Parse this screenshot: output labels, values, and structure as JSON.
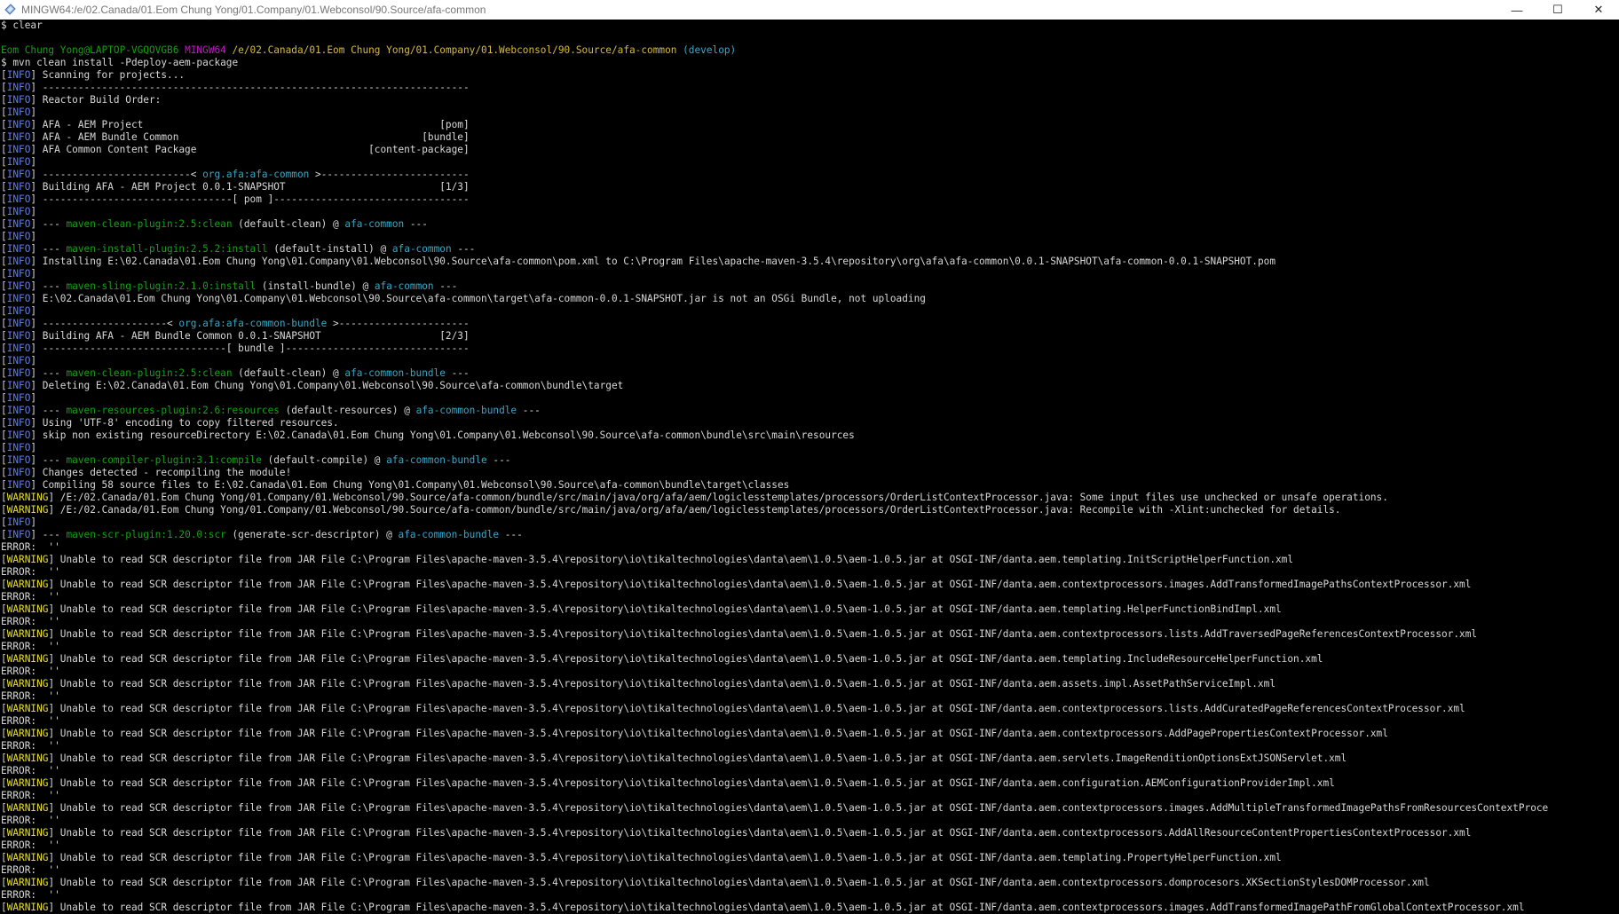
{
  "window": {
    "title": "MINGW64:/e/02.Canada/01.Eom Chung Yong/01.Company/01.Webconsol/90.Source/afa-common",
    "minimize": "—",
    "maximize": "☐",
    "close": "✕"
  },
  "colors": {
    "background": "#000000",
    "text": "#d8d8d8",
    "info_tag": "#5c7cfa",
    "warning_tag": "#e8e02a",
    "plugin": "#16a016",
    "artifact": "#3aa7c8",
    "user": "#13a10e",
    "shell": "#c218c2",
    "path": "#d7ba3e"
  },
  "lines": [
    [
      {
        "t": "$ clear"
      }
    ],
    [
      {
        "t": ""
      }
    ],
    [
      {
        "t": "Eom Chung Yong@LAPTOP-VGQOVGB6 ",
        "c": "green"
      },
      {
        "t": "MINGW64 ",
        "c": "magenta"
      },
      {
        "t": "/e/02.Canada/01.Eom Chung Yong/01.Company/01.Webconsol/90.Source/afa-common",
        "c": "yellow"
      },
      {
        "t": " (develop)",
        "c": "cyan"
      }
    ],
    [
      {
        "t": "$ mvn clean install -Pdeploy-aem-package"
      }
    ],
    [
      {
        "t": "[",
        "c": "white"
      },
      {
        "t": "INFO",
        "c": "blue"
      },
      {
        "t": "] Scanning for projects..."
      }
    ],
    [
      {
        "t": "["
      },
      {
        "t": "INFO",
        "c": "blue"
      },
      {
        "t": "] ------------------------------------------------------------------------"
      }
    ],
    [
      {
        "t": "["
      },
      {
        "t": "INFO",
        "c": "blue"
      },
      {
        "t": "] Reactor Build Order:"
      }
    ],
    [
      {
        "t": "["
      },
      {
        "t": "INFO",
        "c": "blue"
      },
      {
        "t": "]"
      }
    ],
    [
      {
        "t": "["
      },
      {
        "t": "INFO",
        "c": "blue"
      },
      {
        "t": "] AFA - AEM Project                                                  [pom]"
      }
    ],
    [
      {
        "t": "["
      },
      {
        "t": "INFO",
        "c": "blue"
      },
      {
        "t": "] AFA - AEM Bundle Common                                         [bundle]"
      }
    ],
    [
      {
        "t": "["
      },
      {
        "t": "INFO",
        "c": "blue"
      },
      {
        "t": "] AFA Common Content Package                             [content-package]"
      }
    ],
    [
      {
        "t": "["
      },
      {
        "t": "INFO",
        "c": "blue"
      },
      {
        "t": "]"
      }
    ],
    [
      {
        "t": "["
      },
      {
        "t": "INFO",
        "c": "blue"
      },
      {
        "t": "] -------------------------< "
      },
      {
        "t": "org.afa:afa-common",
        "c": "cyan"
      },
      {
        "t": " >-------------------------"
      }
    ],
    [
      {
        "t": "["
      },
      {
        "t": "INFO",
        "c": "blue"
      },
      {
        "t": "] Building AFA - AEM Project 0.0.1-SNAPSHOT                          [1/3]"
      }
    ],
    [
      {
        "t": "["
      },
      {
        "t": "INFO",
        "c": "blue"
      },
      {
        "t": "] --------------------------------[ pom ]---------------------------------"
      }
    ],
    [
      {
        "t": "["
      },
      {
        "t": "INFO",
        "c": "blue"
      },
      {
        "t": "]"
      }
    ],
    [
      {
        "t": "["
      },
      {
        "t": "INFO",
        "c": "blue"
      },
      {
        "t": "] --- "
      },
      {
        "t": "maven-clean-plugin:2.5:clean",
        "c": "plugin"
      },
      {
        "t": " (default-clean) @ "
      },
      {
        "t": "afa-common",
        "c": "cyan"
      },
      {
        "t": " ---"
      }
    ],
    [
      {
        "t": "["
      },
      {
        "t": "INFO",
        "c": "blue"
      },
      {
        "t": "]"
      }
    ],
    [
      {
        "t": "["
      },
      {
        "t": "INFO",
        "c": "blue"
      },
      {
        "t": "] --- "
      },
      {
        "t": "maven-install-plugin:2.5.2:install",
        "c": "plugin"
      },
      {
        "t": " (default-install) @ "
      },
      {
        "t": "afa-common",
        "c": "cyan"
      },
      {
        "t": " ---"
      }
    ],
    [
      {
        "t": "["
      },
      {
        "t": "INFO",
        "c": "blue"
      },
      {
        "t": "] Installing E:\\02.Canada\\01.Eom Chung Yong\\01.Company\\01.Webconsol\\90.Source\\afa-common\\pom.xml to C:\\Program Files\\apache-maven-3.5.4\\repository\\org\\afa\\afa-common\\0.0.1-SNAPSHOT\\afa-common-0.0.1-SNAPSHOT.pom"
      }
    ],
    [
      {
        "t": "["
      },
      {
        "t": "INFO",
        "c": "blue"
      },
      {
        "t": "]"
      }
    ],
    [
      {
        "t": "["
      },
      {
        "t": "INFO",
        "c": "blue"
      },
      {
        "t": "] --- "
      },
      {
        "t": "maven-sling-plugin:2.1.0:install",
        "c": "plugin"
      },
      {
        "t": " (install-bundle) @ "
      },
      {
        "t": "afa-common",
        "c": "cyan"
      },
      {
        "t": " ---"
      }
    ],
    [
      {
        "t": "["
      },
      {
        "t": "INFO",
        "c": "blue"
      },
      {
        "t": "] E:\\02.Canada\\01.Eom Chung Yong\\01.Company\\01.Webconsol\\90.Source\\afa-common\\target\\afa-common-0.0.1-SNAPSHOT.jar is not an OSGi Bundle, not uploading"
      }
    ],
    [
      {
        "t": "["
      },
      {
        "t": "INFO",
        "c": "blue"
      },
      {
        "t": "]"
      }
    ],
    [
      {
        "t": "["
      },
      {
        "t": "INFO",
        "c": "blue"
      },
      {
        "t": "] ---------------------< "
      },
      {
        "t": "org.afa:afa-common-bundle",
        "c": "cyan"
      },
      {
        "t": " >----------------------"
      }
    ],
    [
      {
        "t": "["
      },
      {
        "t": "INFO",
        "c": "blue"
      },
      {
        "t": "] Building AFA - AEM Bundle Common 0.0.1-SNAPSHOT                    [2/3]"
      }
    ],
    [
      {
        "t": "["
      },
      {
        "t": "INFO",
        "c": "blue"
      },
      {
        "t": "] -------------------------------[ bundle ]-------------------------------"
      }
    ],
    [
      {
        "t": "["
      },
      {
        "t": "INFO",
        "c": "blue"
      },
      {
        "t": "]"
      }
    ],
    [
      {
        "t": "["
      },
      {
        "t": "INFO",
        "c": "blue"
      },
      {
        "t": "] --- "
      },
      {
        "t": "maven-clean-plugin:2.5:clean",
        "c": "plugin"
      },
      {
        "t": " (default-clean) @ "
      },
      {
        "t": "afa-common-bundle",
        "c": "cyan"
      },
      {
        "t": " ---"
      }
    ],
    [
      {
        "t": "["
      },
      {
        "t": "INFO",
        "c": "blue"
      },
      {
        "t": "] Deleting E:\\02.Canada\\01.Eom Chung Yong\\01.Company\\01.Webconsol\\90.Source\\afa-common\\bundle\\target"
      }
    ],
    [
      {
        "t": "["
      },
      {
        "t": "INFO",
        "c": "blue"
      },
      {
        "t": "]"
      }
    ],
    [
      {
        "t": "["
      },
      {
        "t": "INFO",
        "c": "blue"
      },
      {
        "t": "] --- "
      },
      {
        "t": "maven-resources-plugin:2.6:resources",
        "c": "plugin"
      },
      {
        "t": " (default-resources) @ "
      },
      {
        "t": "afa-common-bundle",
        "c": "cyan"
      },
      {
        "t": " ---"
      }
    ],
    [
      {
        "t": "["
      },
      {
        "t": "INFO",
        "c": "blue"
      },
      {
        "t": "] Using 'UTF-8' encoding to copy filtered resources."
      }
    ],
    [
      {
        "t": "["
      },
      {
        "t": "INFO",
        "c": "blue"
      },
      {
        "t": "] skip non existing resourceDirectory E:\\02.Canada\\01.Eom Chung Yong\\01.Company\\01.Webconsol\\90.Source\\afa-common\\bundle\\src\\main\\resources"
      }
    ],
    [
      {
        "t": "["
      },
      {
        "t": "INFO",
        "c": "blue"
      },
      {
        "t": "]"
      }
    ],
    [
      {
        "t": "["
      },
      {
        "t": "INFO",
        "c": "blue"
      },
      {
        "t": "] --- "
      },
      {
        "t": "maven-compiler-plugin:3.1:compile",
        "c": "plugin"
      },
      {
        "t": " (default-compile) @ "
      },
      {
        "t": "afa-common-bundle",
        "c": "cyan"
      },
      {
        "t": " ---"
      }
    ],
    [
      {
        "t": "["
      },
      {
        "t": "INFO",
        "c": "blue"
      },
      {
        "t": "] Changes detected - recompiling the module!"
      }
    ],
    [
      {
        "t": "["
      },
      {
        "t": "INFO",
        "c": "blue"
      },
      {
        "t": "] Compiling 58 source files to E:\\02.Canada\\01.Eom Chung Yong\\01.Company\\01.Webconsol\\90.Source\\afa-common\\bundle\\target\\classes"
      }
    ],
    [
      {
        "t": "["
      },
      {
        "t": "WARNING",
        "c": "warn"
      },
      {
        "t": "] /E:/02.Canada/01.Eom Chung Yong/01.Company/01.Webconsol/90.Source/afa-common/bundle/src/main/java/org/afa/aem/logiclesstemplates/processors/OrderListContextProcessor.java: Some input files use unchecked or unsafe operations."
      }
    ],
    [
      {
        "t": "["
      },
      {
        "t": "WARNING",
        "c": "warn"
      },
      {
        "t": "] /E:/02.Canada/01.Eom Chung Yong/01.Company/01.Webconsol/90.Source/afa-common/bundle/src/main/java/org/afa/aem/logiclesstemplates/processors/OrderListContextProcessor.java: Recompile with -Xlint:unchecked for details."
      }
    ],
    [
      {
        "t": "["
      },
      {
        "t": "INFO",
        "c": "blue"
      },
      {
        "t": "]"
      }
    ],
    [
      {
        "t": "["
      },
      {
        "t": "INFO",
        "c": "blue"
      },
      {
        "t": "] --- "
      },
      {
        "t": "maven-scr-plugin:1.20.0:scr",
        "c": "plugin"
      },
      {
        "t": " (generate-scr-descriptor) @ "
      },
      {
        "t": "afa-common-bundle",
        "c": "cyan"
      },
      {
        "t": " ---"
      }
    ],
    [
      {
        "t": "ERROR:  ''"
      }
    ],
    [
      {
        "t": "["
      },
      {
        "t": "WARNING",
        "c": "warn"
      },
      {
        "t": "] Unable to read SCR descriptor file from JAR File C:\\Program Files\\apache-maven-3.5.4\\repository\\io\\tikaltechnologies\\danta\\aem\\1.0.5\\aem-1.0.5.jar at OSGI-INF/danta.aem.templating.InitScriptHelperFunction.xml"
      }
    ],
    [
      {
        "t": "ERROR:  ''"
      }
    ],
    [
      {
        "t": "["
      },
      {
        "t": "WARNING",
        "c": "warn"
      },
      {
        "t": "] Unable to read SCR descriptor file from JAR File C:\\Program Files\\apache-maven-3.5.4\\repository\\io\\tikaltechnologies\\danta\\aem\\1.0.5\\aem-1.0.5.jar at OSGI-INF/danta.aem.contextprocessors.images.AddTransformedImagePathsContextProcessor.xml"
      }
    ],
    [
      {
        "t": "ERROR:  ''"
      }
    ],
    [
      {
        "t": "["
      },
      {
        "t": "WARNING",
        "c": "warn"
      },
      {
        "t": "] Unable to read SCR descriptor file from JAR File C:\\Program Files\\apache-maven-3.5.4\\repository\\io\\tikaltechnologies\\danta\\aem\\1.0.5\\aem-1.0.5.jar at OSGI-INF/danta.aem.templating.HelperFunctionBindImpl.xml"
      }
    ],
    [
      {
        "t": "ERROR:  ''"
      }
    ],
    [
      {
        "t": "["
      },
      {
        "t": "WARNING",
        "c": "warn"
      },
      {
        "t": "] Unable to read SCR descriptor file from JAR File C:\\Program Files\\apache-maven-3.5.4\\repository\\io\\tikaltechnologies\\danta\\aem\\1.0.5\\aem-1.0.5.jar at OSGI-INF/danta.aem.contextprocessors.lists.AddTraversedPageReferencesContextProcessor.xml"
      }
    ],
    [
      {
        "t": "ERROR:  ''"
      }
    ],
    [
      {
        "t": "["
      },
      {
        "t": "WARNING",
        "c": "warn"
      },
      {
        "t": "] Unable to read SCR descriptor file from JAR File C:\\Program Files\\apache-maven-3.5.4\\repository\\io\\tikaltechnologies\\danta\\aem\\1.0.5\\aem-1.0.5.jar at OSGI-INF/danta.aem.templating.IncludeResourceHelperFunction.xml"
      }
    ],
    [
      {
        "t": "ERROR:  ''"
      }
    ],
    [
      {
        "t": "["
      },
      {
        "t": "WARNING",
        "c": "warn"
      },
      {
        "t": "] Unable to read SCR descriptor file from JAR File C:\\Program Files\\apache-maven-3.5.4\\repository\\io\\tikaltechnologies\\danta\\aem\\1.0.5\\aem-1.0.5.jar at OSGI-INF/danta.aem.assets.impl.AssetPathServiceImpl.xml"
      }
    ],
    [
      {
        "t": "ERROR:  ''"
      }
    ],
    [
      {
        "t": "["
      },
      {
        "t": "WARNING",
        "c": "warn"
      },
      {
        "t": "] Unable to read SCR descriptor file from JAR File C:\\Program Files\\apache-maven-3.5.4\\repository\\io\\tikaltechnologies\\danta\\aem\\1.0.5\\aem-1.0.5.jar at OSGI-INF/danta.aem.contextprocessors.lists.AddCuratedPageReferencesContextProcessor.xml"
      }
    ],
    [
      {
        "t": "ERROR:  ''"
      }
    ],
    [
      {
        "t": "["
      },
      {
        "t": "WARNING",
        "c": "warn"
      },
      {
        "t": "] Unable to read SCR descriptor file from JAR File C:\\Program Files\\apache-maven-3.5.4\\repository\\io\\tikaltechnologies\\danta\\aem\\1.0.5\\aem-1.0.5.jar at OSGI-INF/danta.aem.contextprocessors.AddPagePropertiesContextProcessor.xml"
      }
    ],
    [
      {
        "t": "ERROR:  ''"
      }
    ],
    [
      {
        "t": "["
      },
      {
        "t": "WARNING",
        "c": "warn"
      },
      {
        "t": "] Unable to read SCR descriptor file from JAR File C:\\Program Files\\apache-maven-3.5.4\\repository\\io\\tikaltechnologies\\danta\\aem\\1.0.5\\aem-1.0.5.jar at OSGI-INF/danta.aem.servlets.ImageRenditionOptionsExtJSONServlet.xml"
      }
    ],
    [
      {
        "t": "ERROR:  ''"
      }
    ],
    [
      {
        "t": "["
      },
      {
        "t": "WARNING",
        "c": "warn"
      },
      {
        "t": "] Unable to read SCR descriptor file from JAR File C:\\Program Files\\apache-maven-3.5.4\\repository\\io\\tikaltechnologies\\danta\\aem\\1.0.5\\aem-1.0.5.jar at OSGI-INF/danta.aem.configuration.AEMConfigurationProviderImpl.xml"
      }
    ],
    [
      {
        "t": "ERROR:  ''"
      }
    ],
    [
      {
        "t": "["
      },
      {
        "t": "WARNING",
        "c": "warn"
      },
      {
        "t": "] Unable to read SCR descriptor file from JAR File C:\\Program Files\\apache-maven-3.5.4\\repository\\io\\tikaltechnologies\\danta\\aem\\1.0.5\\aem-1.0.5.jar at OSGI-INF/danta.aem.contextprocessors.images.AddMultipleTransformedImagePathsFromResourcesContextProce"
      }
    ],
    [
      {
        "t": "ERROR:  ''"
      }
    ],
    [
      {
        "t": "["
      },
      {
        "t": "WARNING",
        "c": "warn"
      },
      {
        "t": "] Unable to read SCR descriptor file from JAR File C:\\Program Files\\apache-maven-3.5.4\\repository\\io\\tikaltechnologies\\danta\\aem\\1.0.5\\aem-1.0.5.jar at OSGI-INF/danta.aem.contextprocessors.AddAllResourceContentPropertiesContextProcessor.xml"
      }
    ],
    [
      {
        "t": "ERROR:  ''"
      }
    ],
    [
      {
        "t": "["
      },
      {
        "t": "WARNING",
        "c": "warn"
      },
      {
        "t": "] Unable to read SCR descriptor file from JAR File C:\\Program Files\\apache-maven-3.5.4\\repository\\io\\tikaltechnologies\\danta\\aem\\1.0.5\\aem-1.0.5.jar at OSGI-INF/danta.aem.templating.PropertyHelperFunction.xml"
      }
    ],
    [
      {
        "t": "ERROR:  ''"
      }
    ],
    [
      {
        "t": "["
      },
      {
        "t": "WARNING",
        "c": "warn"
      },
      {
        "t": "] Unable to read SCR descriptor file from JAR File C:\\Program Files\\apache-maven-3.5.4\\repository\\io\\tikaltechnologies\\danta\\aem\\1.0.5\\aem-1.0.5.jar at OSGI-INF/danta.aem.contextprocessors.domprocesors.XKSectionStylesDOMProcessor.xml"
      }
    ],
    [
      {
        "t": "ERROR:  ''"
      }
    ],
    [
      {
        "t": "["
      },
      {
        "t": "WARNING",
        "c": "warn"
      },
      {
        "t": "] Unable to read SCR descriptor file from JAR File C:\\Program Files\\apache-maven-3.5.4\\repository\\io\\tikaltechnologies\\danta\\aem\\1.0.5\\aem-1.0.5.jar at OSGI-INF/danta.aem.contextprocessors.images.AddTransformedImagePathFromGlobalContextProcessor.xml"
      }
    ]
  ]
}
